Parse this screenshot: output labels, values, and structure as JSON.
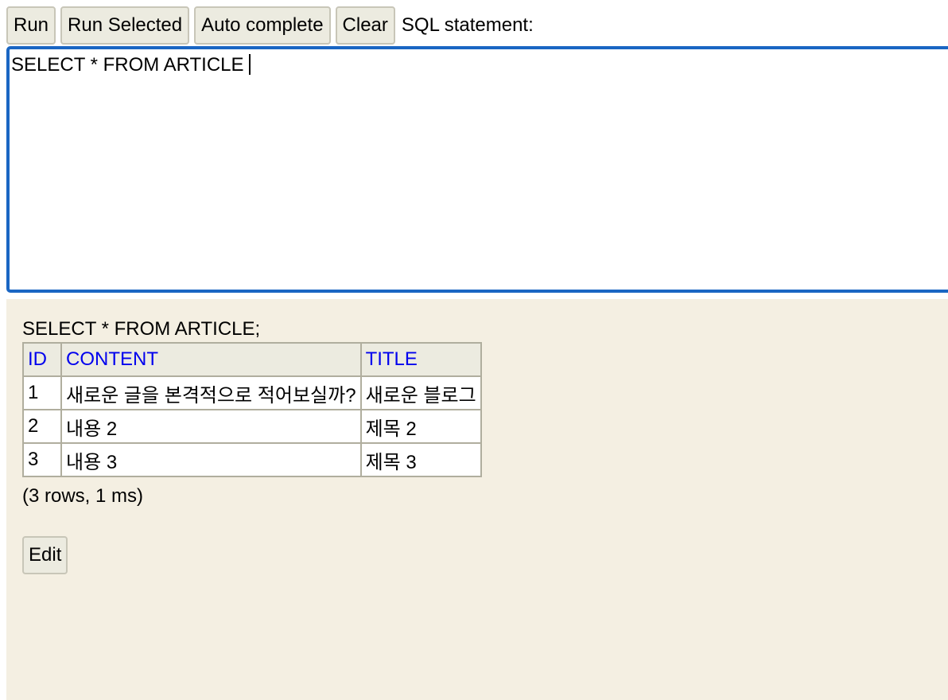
{
  "toolbar": {
    "run_label": "Run",
    "run_selected_label": "Run Selected",
    "auto_complete_label": "Auto complete",
    "clear_label": "Clear",
    "sql_statement_label": "SQL statement:"
  },
  "editor": {
    "value": "SELECT * FROM ARTICLE"
  },
  "result": {
    "query": "SELECT * FROM ARTICLE;",
    "columns": [
      "ID",
      "CONTENT",
      "TITLE"
    ],
    "rows": [
      [
        "1",
        "새로운 글을 본격적으로 적어보실까?",
        "새로운 블로그"
      ],
      [
        "2",
        "내용 2",
        "제목 2"
      ],
      [
        "3",
        "내용 3",
        "제목 3"
      ]
    ],
    "summary": "(3 rows, 1 ms)",
    "edit_label": "Edit"
  },
  "colors": {
    "editor_border": "#1a66c3",
    "result_background": "#f4efe2",
    "header_link": "#0000ee",
    "button_background": "#ecebe0"
  }
}
